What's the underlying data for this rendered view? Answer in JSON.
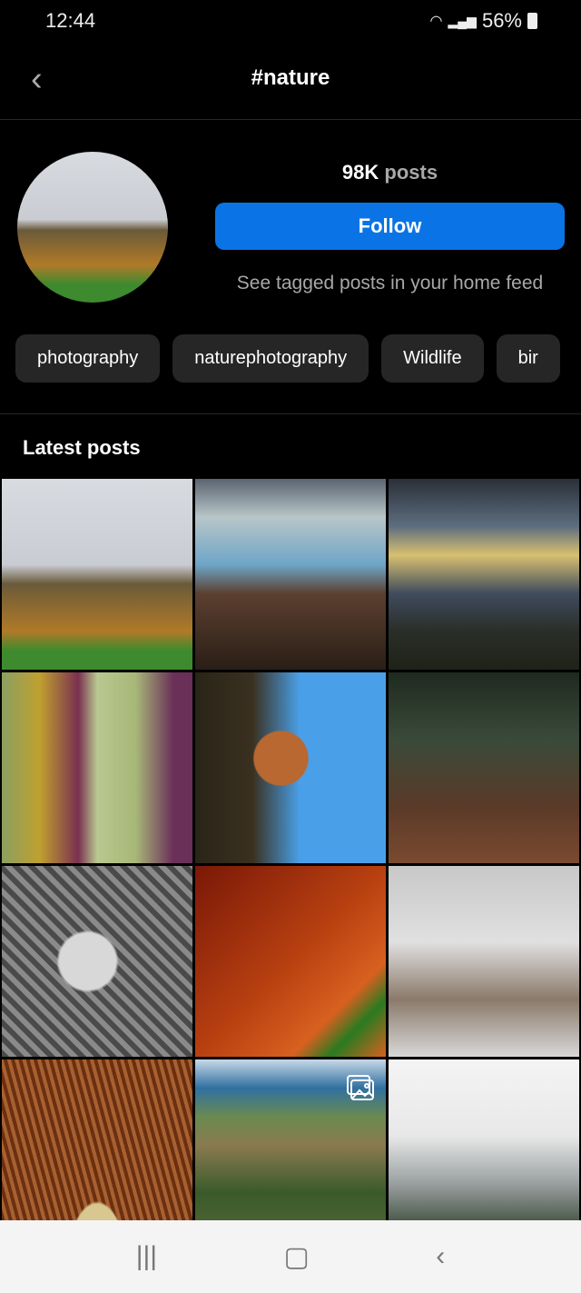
{
  "status": {
    "time": "12:44",
    "battery": "56%"
  },
  "header": {
    "title": "#nature"
  },
  "profile": {
    "post_count": "98K",
    "posts_label": "posts",
    "follow_label": "Follow",
    "hint": "See tagged posts in your home feed"
  },
  "related_tags": [
    "photography",
    "naturephotography",
    "Wildlife",
    "bir"
  ],
  "section_title": "Latest posts",
  "posts": [
    {
      "bg": "linear-gradient(180deg,#d8dbe0 0%,#c9ccd2 45%,#6a5a3a 55%,#b07a28 80%,#3e8a2e 90%,#3e8a2e 100%)"
    },
    {
      "bg": "linear-gradient(180deg,#5a6470 0%,#b8c6c8 20%,#6ea5c8 45%,#5c4030 60%,#2a1e16 100%)"
    },
    {
      "bg": "linear-gradient(180deg,#2a3038 0%,#5e6e80 25%,#d8c070 40%,#404c5e 60%,#2a2e28 80%,#1e2218 100%)"
    },
    {
      "bg": "linear-gradient(90deg,#8aa060 0%,#c0a030 20%,#7a3050 40%,#b8c890 50%,#a8b878 70%,#6a3058 90%)"
    },
    {
      "bg": "radial-gradient(circle at 45% 45%,#b86830 0 18%,transparent 19%),linear-gradient(90deg,#2a2418 0%,#3a3020 30%,#4aa0e8 55%,#4aa0e8 100%)"
    },
    {
      "bg": "linear-gradient(180deg,#1e2a1e 0%,#3a4a3a 35%,#5a3a28 70%,#7a4a30 100%)"
    },
    {
      "bg": "radial-gradient(circle at 45% 50%,#d8d8d8 0 20%,transparent 22%),repeating-linear-gradient(45deg,#4a4a4a 0 6px,#8a8a8a 6px 12px)"
    },
    {
      "bg": "linear-gradient(135deg,#7a1808 0%,#b84010 50%,#d86020 75%,#2a7a20 85%,#d86020 100%)"
    },
    {
      "bg": "linear-gradient(180deg,#c8c8c8 0%,#e0e0e0 40%,#8a7a6a 70%,#d8d8d8 100%)"
    },
    {
      "bg": "radial-gradient(ellipse at 50% 110%,#d8c890 0 22%,transparent 23%),repeating-linear-gradient(75deg,#6a3010 0 4px,#a86030 4px 8px)"
    },
    {
      "bg": "linear-gradient(180deg,#c8d8e8 0%,#3070a0 15%,#6a8a50 30%,#8a7a50 45%,#3a5a2a 70%,#5a6a3a 100%)",
      "multi": true
    },
    {
      "bg": "linear-gradient(180deg,#f4f4f4 0%,#e8e8e8 40%,#9aa0a0 65%,#4a5a4a 85%,#8a80b0 100%)"
    }
  ]
}
